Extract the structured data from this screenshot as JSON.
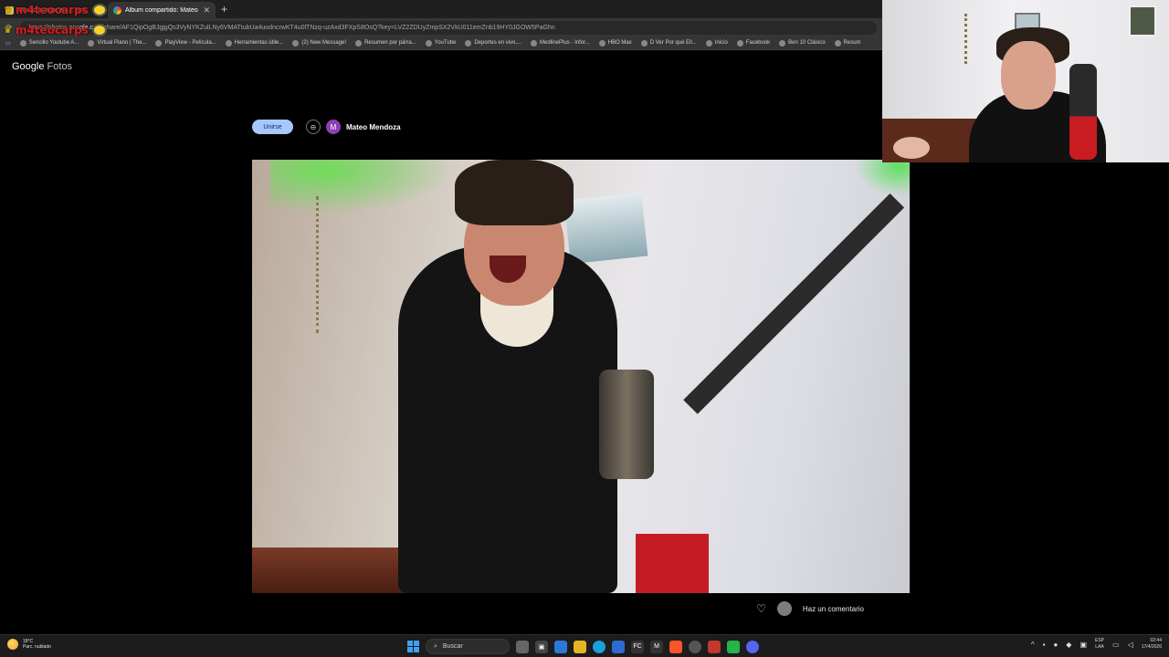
{
  "browser": {
    "tabs": [
      {
        "label": "Meuvo acada, ala... emc",
        "active": false
      },
      {
        "label": "Álbum compartido: Mateo Mendoza",
        "active": true
      }
    ],
    "new_tab": "+",
    "url_prefix": "https://photos.goo",
    "url_domain": "gle.com",
    "url_rest": "/share/AF1QipOgBJgjgQs3VyNYKZulLNy6VMATtubUa4uodncrwKT4u0lTNzq-uzAxd3FXpS8OsQ?key=LVZ2ZDUyZmpSX2VkU011emZnb19HY0JGOW5PaGhn",
    "bookmarks": [
      "Sencillo Youtube A...",
      "Virtual Piano | The...",
      "PlayView - Película...",
      "Herramientas útile...",
      "(2) New Message!",
      "Resumen por párra...",
      "YouTube",
      "Deportes en vivo,...",
      "MedlinePlus - Infor...",
      "HBO Max",
      "D Ver Por qué Ell...",
      "Inicio",
      "Facebook",
      "Ben 10 Clásico",
      "Resum"
    ]
  },
  "stream_overlay": {
    "channel": "m4teocarps"
  },
  "photos": {
    "logo_google": "Google",
    "logo_product": "Fotos",
    "join_label": "Unirse",
    "link_icon": "link-icon",
    "owner_initial": "M",
    "owner_name": "Mateo Mendoza",
    "comment_label": "Haz un comentario"
  },
  "taskbar": {
    "weather_temp": "18°C",
    "weather_desc": "Parc. nublado",
    "search_label": "Buscar",
    "lang_top": "ESP",
    "lang_bottom": "LAA",
    "time": "02:44",
    "date": "17/4/2026"
  }
}
